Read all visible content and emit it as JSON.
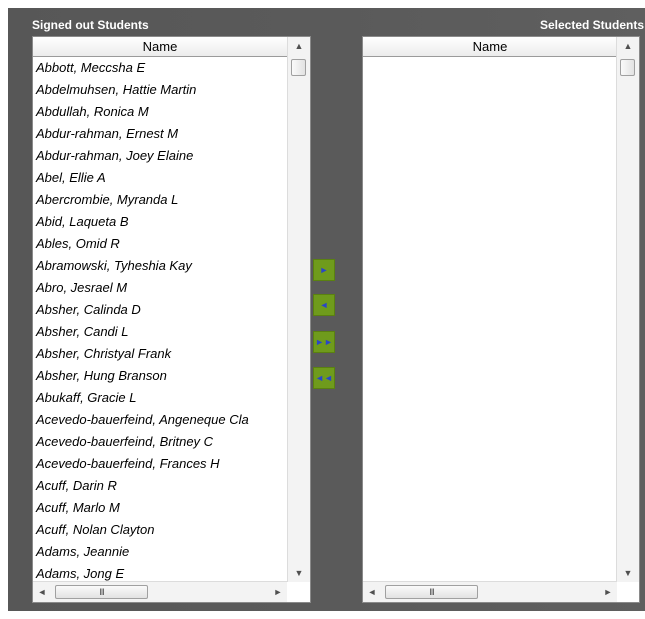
{
  "headers": {
    "left_title": "Signed out Students",
    "right_title": "Selected Students"
  },
  "left_panel": {
    "column_header": "Name",
    "students": [
      "Abbott, Meccsha E",
      "Abdelmuhsen, Hattie Martin",
      "Abdullah, Ronica M",
      "Abdur-rahman, Ernest M",
      "Abdur-rahman, Joey Elaine",
      "Abel, Ellie A",
      "Abercrombie, Myranda L",
      "Abid, Laqueta B",
      "Ables, Omid R",
      "Abramowski, Tyheshia Kay",
      "Abro, Jesrael M",
      "Absher, Calinda D",
      "Absher, Candi L",
      "Absher, Christyal Frank",
      "Absher, Hung Branson",
      "Abukaff, Gracie L",
      "Acevedo-bauerfeind, Angeneque Cla",
      "Acevedo-bauerfeind, Britney C",
      "Acevedo-bauerfeind, Frances H",
      "Acuff, Darin R",
      "Acuff, Marlo M",
      "Acuff, Nolan Clayton",
      "Adams, Jeannie",
      "Adams, Jong E"
    ]
  },
  "right_panel": {
    "column_header": "Name"
  },
  "scrollbar": {
    "up_glyph": "▲",
    "down_glyph": "▼",
    "left_glyph": "◄",
    "right_glyph": "►",
    "thumb_grip": "III"
  },
  "buttons": {
    "move_selected": "►",
    "remove_selected": "◄",
    "move_all": "►►",
    "remove_all": "◄◄"
  },
  "colors": {
    "background": "#5a5a5a",
    "button": "#6f9b1c",
    "button_arrow": "#2a46c8"
  }
}
